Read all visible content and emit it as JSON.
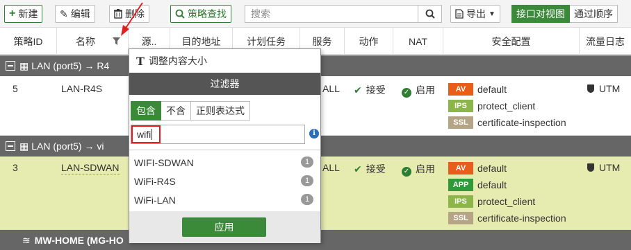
{
  "toolbar": {
    "new_label": "新建",
    "edit_label": "编辑",
    "delete_label": "删除",
    "policy_search_label": "策略查找",
    "search_placeholder": "搜索",
    "export_label": "导出",
    "view_interface": "接口对视图",
    "view_sequence": "通过顺序"
  },
  "columns": [
    "策略ID",
    "名称",
    "源..",
    "目的地址",
    "计划任务",
    "服务",
    "动作",
    "NAT",
    "安全配置",
    "流量日志"
  ],
  "groups": [
    {
      "label": "LAN (port5) → R4",
      "interface": "LAN (port5)"
    },
    {
      "label": "LAN (port5) → vi",
      "interface": "LAN (port5)"
    },
    {
      "label": "MW-HOME (MG-HO",
      "interface": "MW-HOME"
    }
  ],
  "rows": [
    {
      "id": "5",
      "name": "LAN-R4S",
      "service": "ALL",
      "action": "接受",
      "nat": "启用",
      "security": [
        {
          "badge": "AV",
          "profile": "default"
        },
        {
          "badge": "IPS",
          "profile": "protect_client"
        },
        {
          "badge": "SSL",
          "profile": "certificate-inspection"
        }
      ],
      "log": "UTM"
    },
    {
      "id": "3",
      "name": "LAN-SDWAN",
      "service": "ALL",
      "action": "接受",
      "nat": "启用",
      "security": [
        {
          "badge": "AV",
          "profile": "default"
        },
        {
          "badge": "APP",
          "profile": "default"
        },
        {
          "badge": "IPS",
          "profile": "protect_client"
        },
        {
          "badge": "SSL",
          "profile": "certificate-inspection"
        }
      ],
      "log": "UTM"
    }
  ],
  "filter_popup": {
    "resize_label": "调整内容大小",
    "header": "过滤器",
    "tabs": [
      "包含",
      "不含",
      "正则表达式"
    ],
    "input_value": "wifi",
    "options": [
      {
        "label": "WIFI-SDWAN",
        "count": "1"
      },
      {
        "label": "WiFi-R4S",
        "count": "1"
      },
      {
        "label": "WiFi-LAN",
        "count": "1"
      }
    ],
    "apply_label": "应用"
  },
  "colors": {
    "accent_green": "#3a8a3a",
    "highlight_row": "#e6ebb0",
    "group_bg": "#666666",
    "annotation_red": "#e02020"
  }
}
